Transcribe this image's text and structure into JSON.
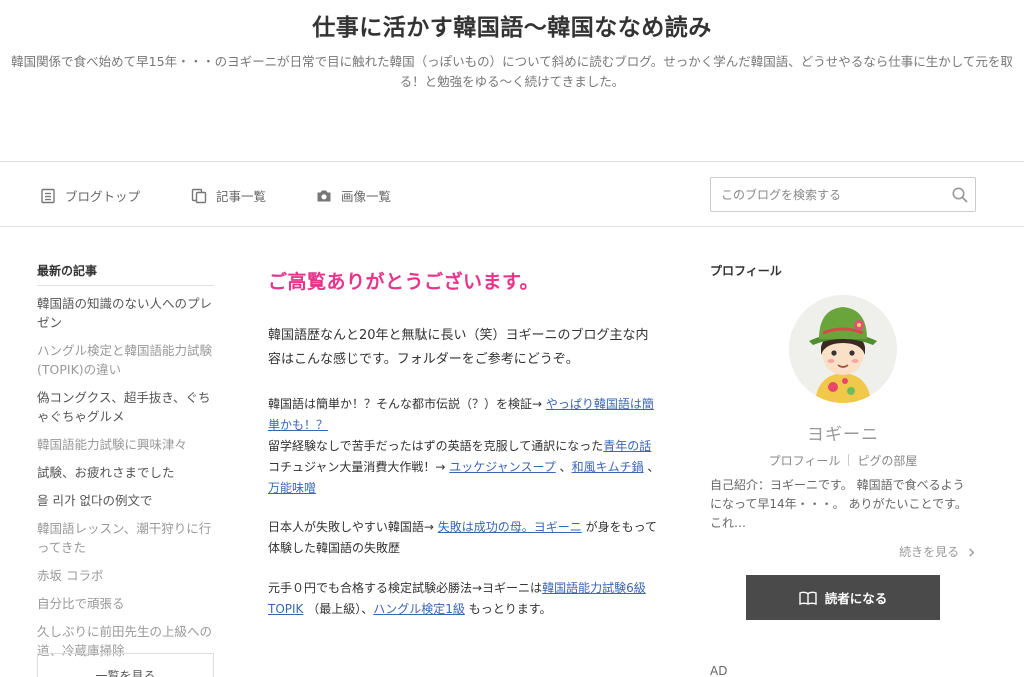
{
  "header": {
    "title": "仕事に活かす韓国語〜韓国ななめ読み",
    "description": "韓国関係で食べ始めて早15年・・・のヨギーニが日常で目に触れた韓国（っぽいもの）について斜めに読むブログ。せっかく学んだ韓国語、どうせやるなら仕事に生かして元を取る！と勉強をゆる〜く続けてきました。"
  },
  "nav": {
    "items": [
      {
        "label": "ブログトップ",
        "icon": "document-icon"
      },
      {
        "label": "記事一覧",
        "icon": "copy-icon"
      },
      {
        "label": "画像一覧",
        "icon": "camera-icon"
      }
    ],
    "search": {
      "placeholder": "このブログを検索する",
      "value": ""
    }
  },
  "sidebar": {
    "heading": "最新の記事",
    "items": [
      {
        "label": "韓国語の知識のない人へのプレゼン",
        "tone": "dark"
      },
      {
        "label": "ハングル検定と韓国語能力試験(TOPIK)の違い",
        "tone": "dim"
      },
      {
        "label": "偽コングクス、超手抜き、ぐちゃぐちゃグルメ",
        "tone": "dark"
      },
      {
        "label": "韓国語能力試験に興味津々",
        "tone": "dim"
      },
      {
        "label": "試験、お疲れさまでした",
        "tone": "dark"
      },
      {
        "label": "을 리가 없다の例文で",
        "tone": "dark"
      },
      {
        "label": "韓国語レッスン、潮干狩りに行ってきた",
        "tone": "dim"
      },
      {
        "label": "赤坂 コラボ",
        "tone": "dim"
      },
      {
        "label": "自分比で頑張る",
        "tone": "dim"
      },
      {
        "label": "久しぶりに前田先生の上級への道、冷蔵庫掃除",
        "tone": "dim"
      }
    ],
    "more_label": "一覧を見る"
  },
  "main": {
    "title": "ご高覧ありがとうございます。",
    "intro": "韓国語歴なんと20年と無駄に長い（笑）ヨギーニのブログ主な内容はこんな感じです。フォルダーをご参考にどうぞ。",
    "p1": {
      "l1_text": "韓国語は簡単か！？そんな都市伝説（？）を検証→ ",
      "l1_link": "やっぱり韓国語は簡単かも！？",
      "l2_text": "留学経験なしで苦手だったはずの英語を克服して通訳になった",
      "l2_link": "青年の話",
      "l3_text": "コチュジャン大量消費大作戦！→ ",
      "l3_link1": "ユッケジャンスープ",
      "l3_sep1": " 、",
      "l3_link2": "和風キムチ鍋",
      "l3_sep2": " 、",
      "l3_link3": "万能味噌"
    },
    "p2": {
      "text1": "日本人が失敗しやすい韓国語→ ",
      "link": "失敗は成功の母。ヨギーニ",
      "text2": " が身をもって体験した韓国語の失敗歴"
    },
    "p3": {
      "text1": "元手０円でも合格する検定試験必勝法→ヨギーニは",
      "link1": "韓国語能力試験6級TOPIK",
      "text2": " （最上級）、",
      "link2": "ハングル検定1級",
      "text3": " もっとります。"
    }
  },
  "profile": {
    "heading": "プロフィール",
    "name": "ヨギーニ",
    "link1": "プロフィール",
    "link2": "ピグの部屋",
    "intro": "自己紹介：ヨギーニです。 韓国語で食べるようになって早14年・・・。 ありがたいことです。 これ…",
    "read_more": "続きを見る",
    "subscribe": "読者になる"
  },
  "ad": {
    "label": "AD"
  },
  "colors": {
    "accent_pink": "#e8348b",
    "link_blue": "#3b66b4",
    "button_dark": "#4a4a4a"
  }
}
